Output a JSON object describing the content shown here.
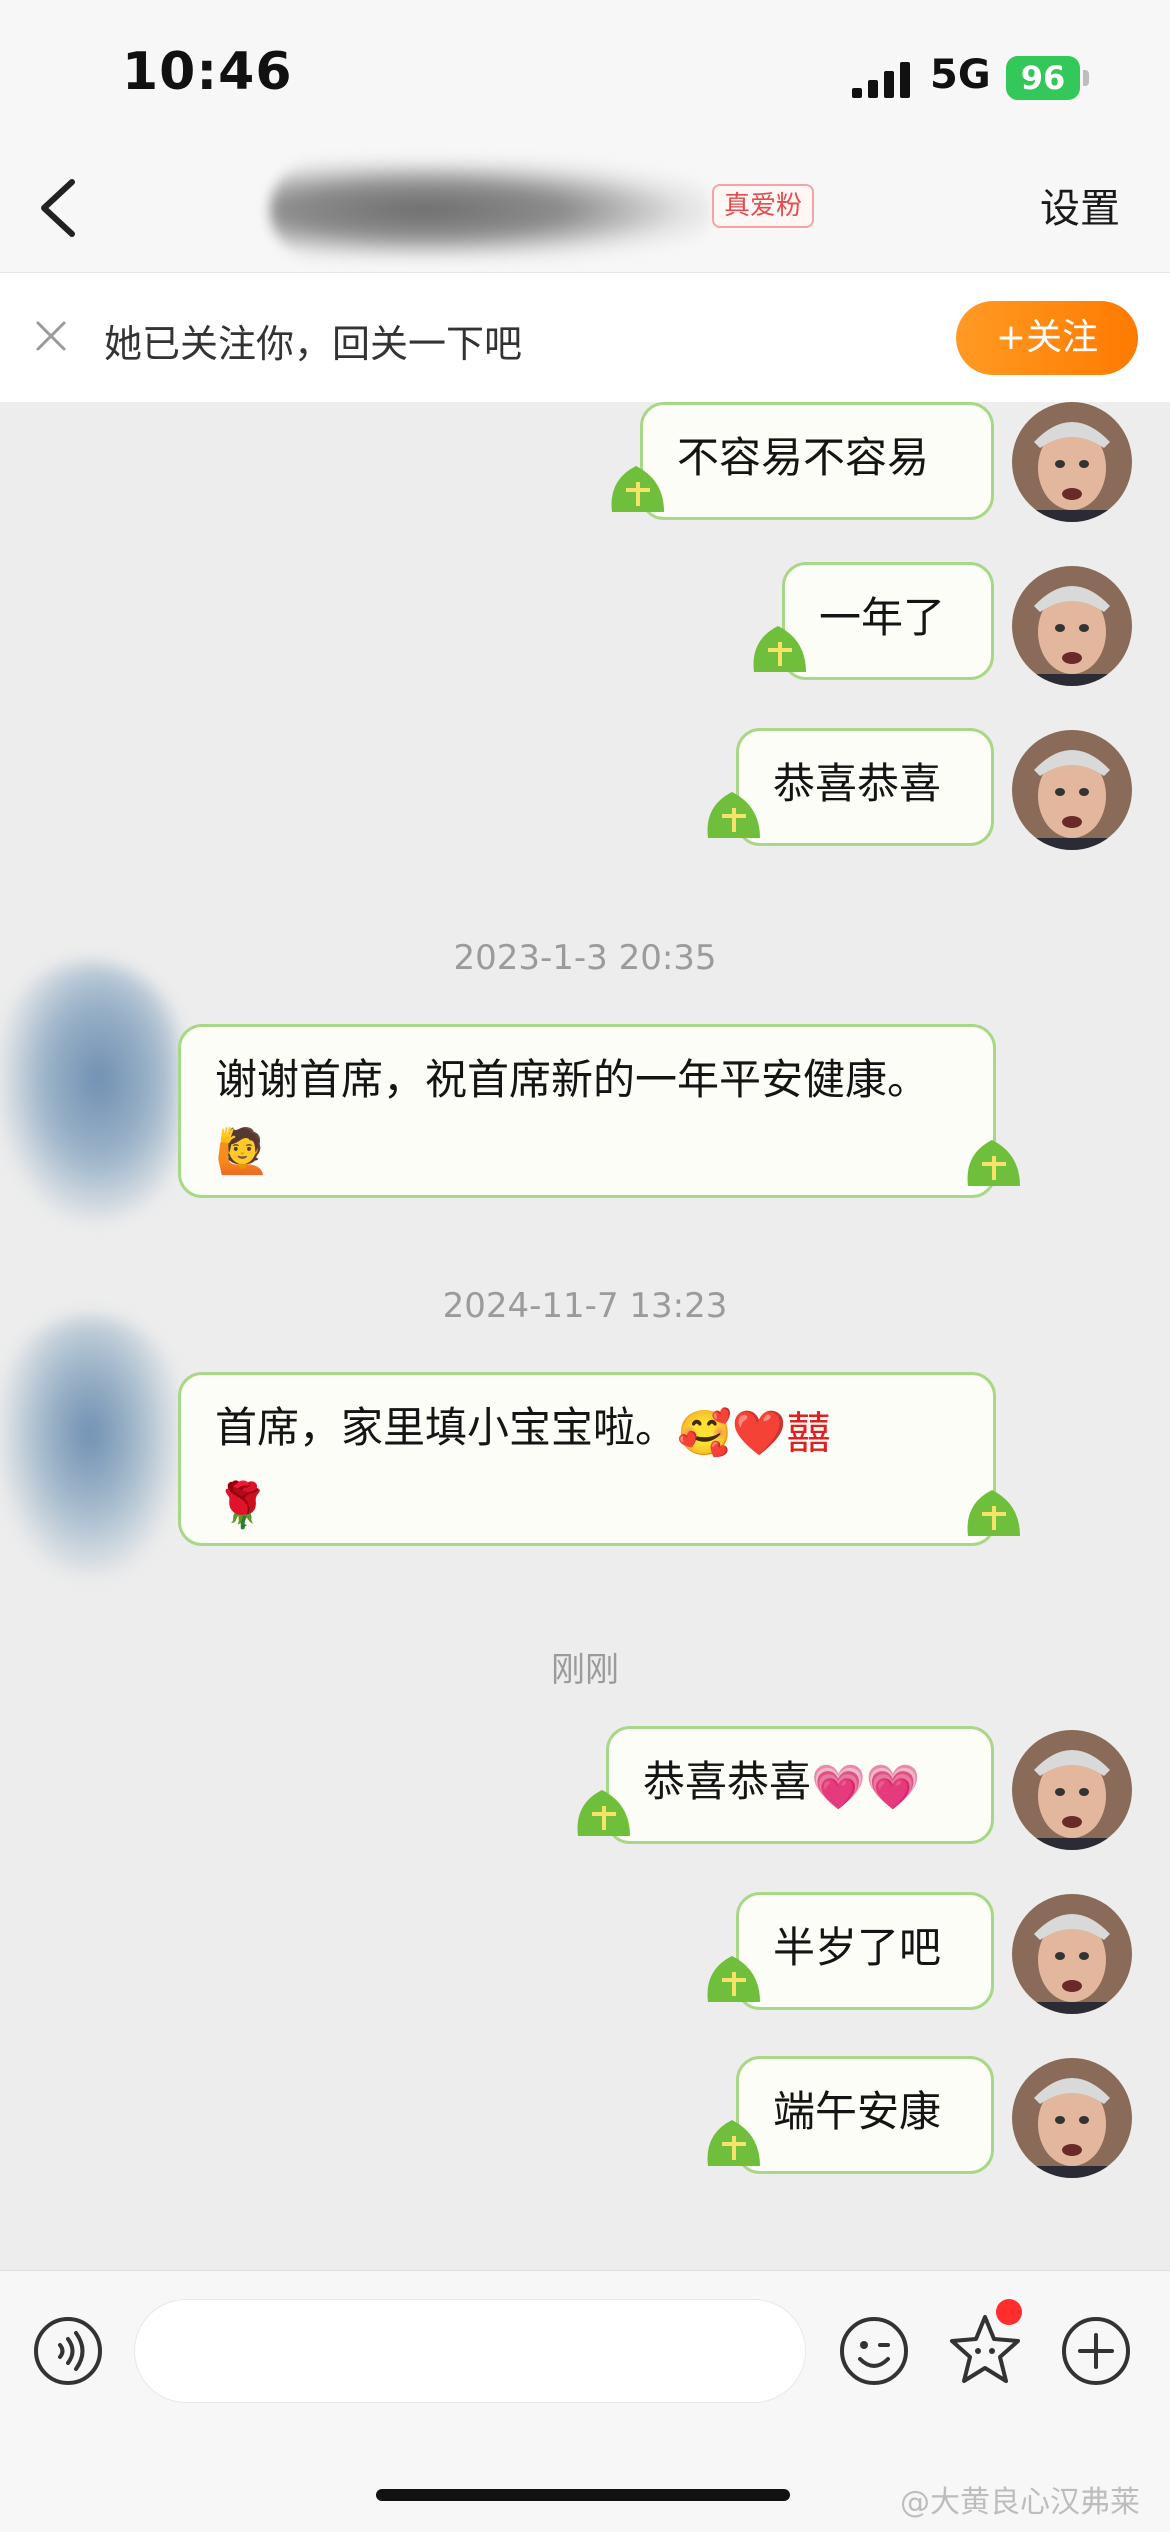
{
  "status_bar": {
    "time": "10:46",
    "network": "5G",
    "battery": "96"
  },
  "nav": {
    "fan_badge": "真爱粉",
    "settings": "设置"
  },
  "follow_banner": {
    "text": "她已关注你，回关一下吧",
    "button": "+关注"
  },
  "messages": [
    {
      "side": "right",
      "text": "不容易不容易"
    },
    {
      "side": "right",
      "text": "一年了"
    },
    {
      "side": "right",
      "text": "恭喜恭喜"
    },
    {
      "type": "timestamp",
      "text": "2023-1-3 20:35"
    },
    {
      "side": "left",
      "text": "谢谢首席，祝首席新的一年平安健康。",
      "emoji": "🙋"
    },
    {
      "type": "timestamp",
      "text": "2024-11-7 13:23"
    },
    {
      "side": "left",
      "text": "首席，家里填小宝宝啦。",
      "emoji": "🥰❤️囍",
      "emoji_line2": "🌹"
    },
    {
      "type": "timestamp",
      "text": "刚刚"
    },
    {
      "side": "right",
      "text": "恭喜恭喜",
      "emoji": "💗💗"
    },
    {
      "side": "right",
      "text": "半岁了吧"
    },
    {
      "side": "right",
      "text": "端午安康"
    }
  ],
  "watermark": "@大黄良心汉弗莱",
  "colors": {
    "bubble_border": "#a9d788",
    "follow_button": "#ff8a10",
    "badge": "#e14d4d",
    "battery": "#34c759"
  }
}
